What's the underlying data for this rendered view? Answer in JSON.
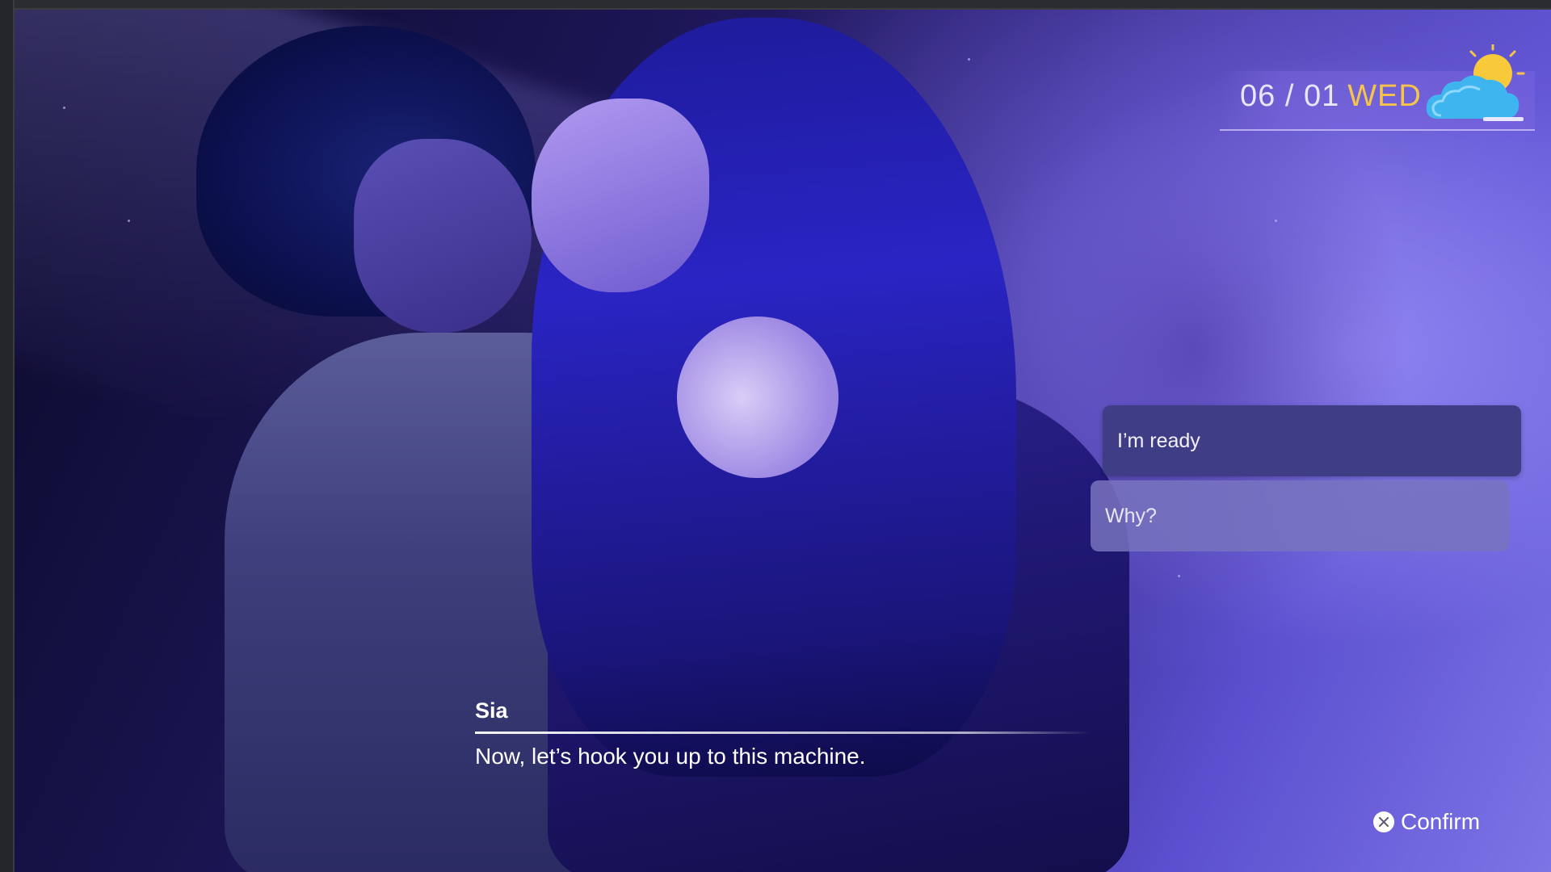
{
  "hud": {
    "date": "06 / 01",
    "weekday": "WED",
    "weather_icon": "partly-sunny-icon"
  },
  "choices": [
    {
      "label": "I’m ready"
    },
    {
      "label": "Why?"
    }
  ],
  "dialogue": {
    "speaker": "Sia",
    "text": "Now, let’s hook you up to this machine."
  },
  "prompt": {
    "button_icon": "cross-button-icon",
    "label": "Confirm"
  },
  "colors": {
    "weekday": "#f6c44a",
    "choice_selected": "#3f3d85",
    "choice_unselected": "#7873be"
  }
}
